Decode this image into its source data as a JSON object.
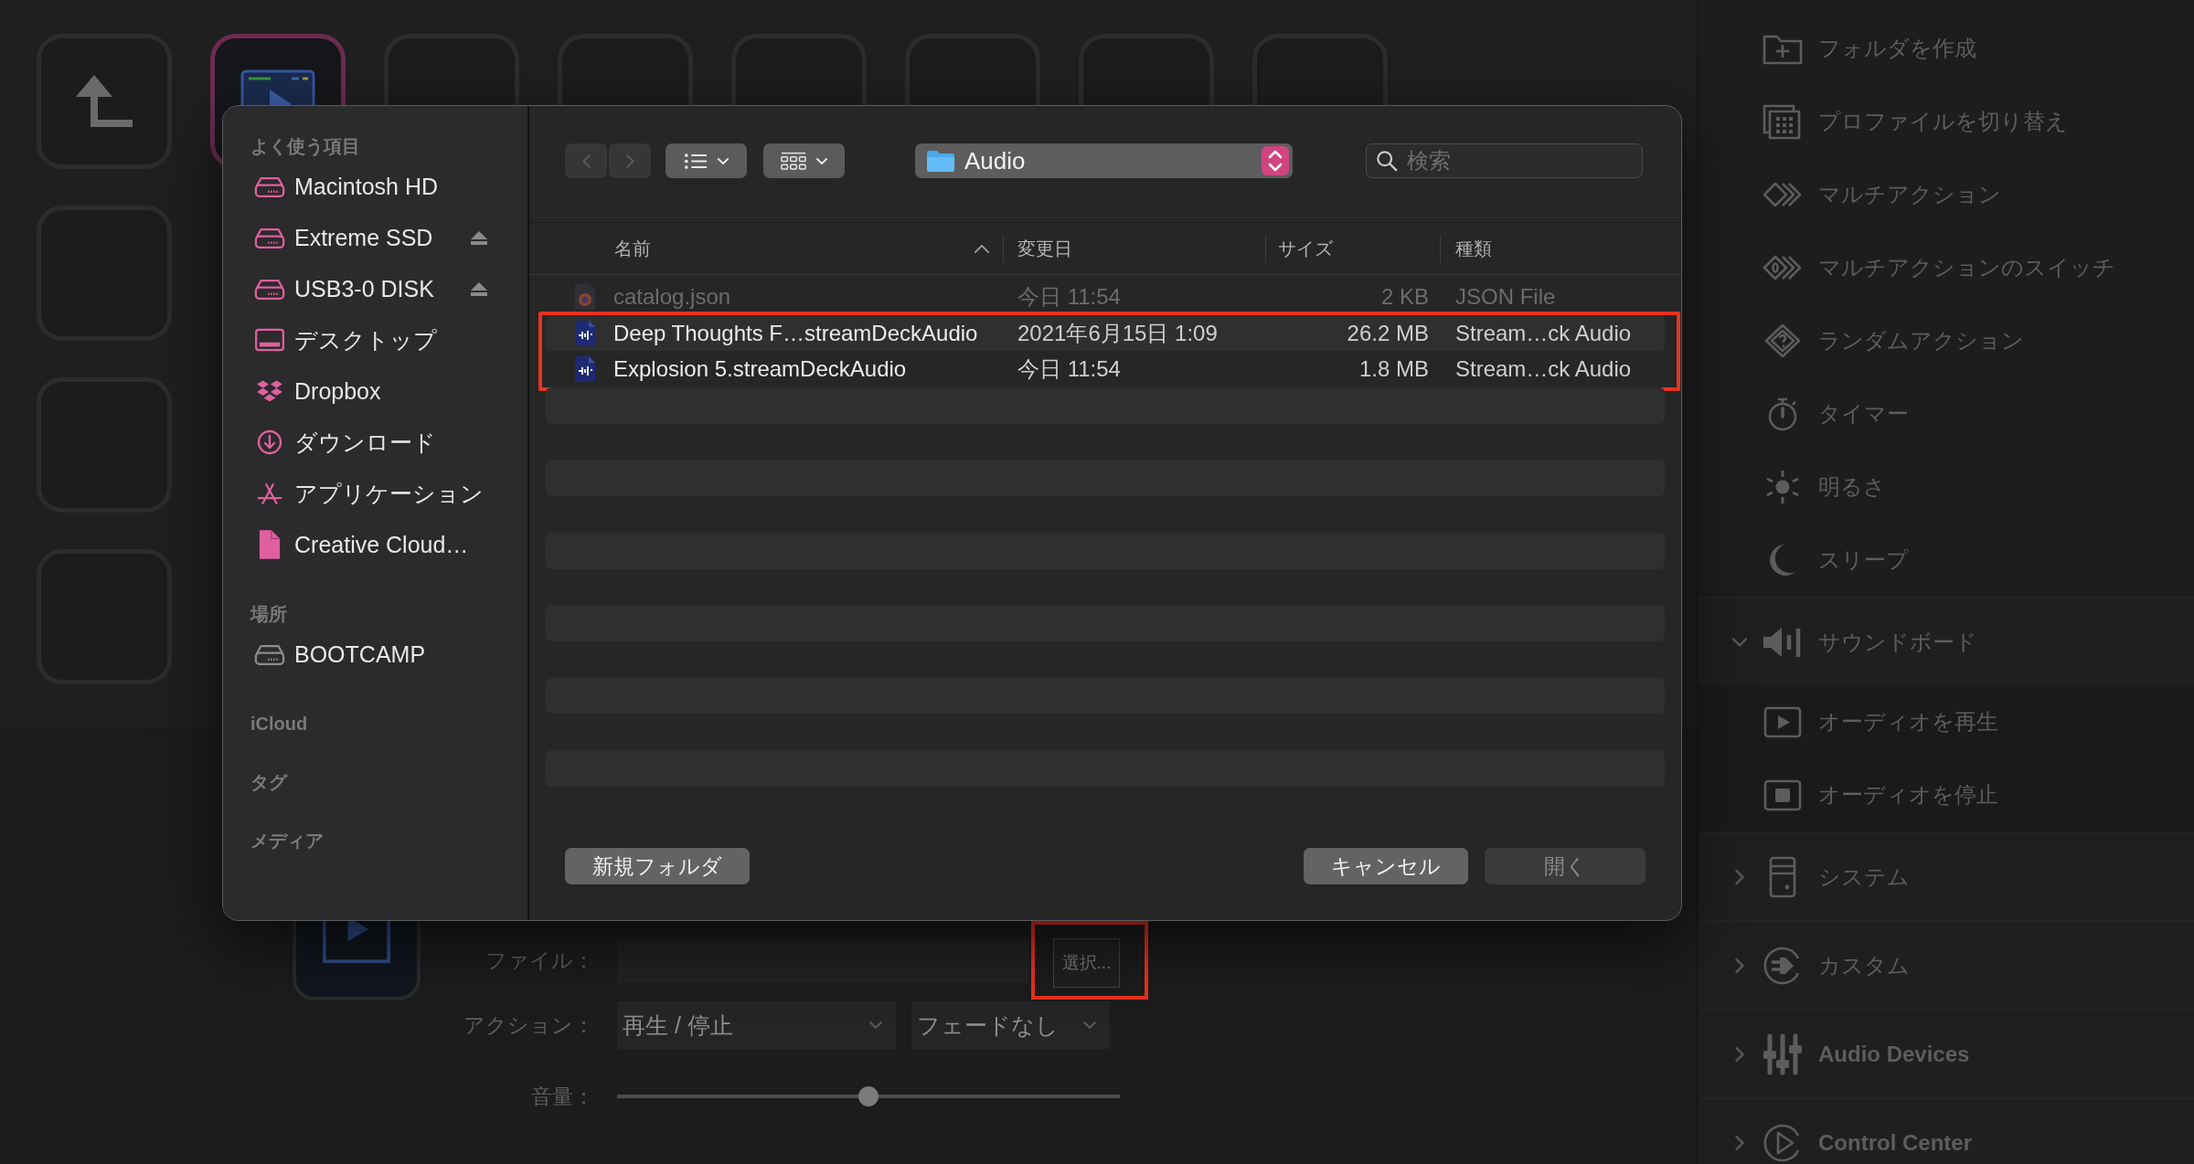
{
  "deck": {
    "rows": [
      {
        "keys": [
          {
            "kind": "back",
            "selected": false
          },
          {
            "kind": "audio",
            "selected": true
          },
          {
            "kind": "empty",
            "selected": false
          },
          {
            "kind": "empty",
            "selected": false
          },
          {
            "kind": "empty",
            "selected": false
          },
          {
            "kind": "empty",
            "selected": false
          },
          {
            "kind": "empty",
            "selected": false
          },
          {
            "kind": "empty",
            "selected": false
          }
        ]
      },
      {
        "keys": [
          {
            "kind": "empty",
            "selected": false
          }
        ]
      },
      {
        "keys": [
          {
            "kind": "empty",
            "selected": false
          }
        ]
      },
      {
        "keys": [
          {
            "kind": "empty",
            "selected": false
          }
        ]
      }
    ]
  },
  "inspector": {
    "file": {
      "label": "ファイル：",
      "button": "選択...",
      "highlighted": true
    },
    "action": {
      "label": "アクション：",
      "mode": "再生 / 停止",
      "fade": "フェードなし"
    },
    "volume": {
      "label": "音量：",
      "level": 0.5
    }
  },
  "dialog": {
    "sidebar": {
      "sections": [
        {
          "title": "よく使う項目",
          "items": [
            {
              "label": "Macintosh HD",
              "kind": "drive",
              "color": "#e0609f",
              "ejectable": false
            },
            {
              "label": "Extreme SSD",
              "kind": "drive",
              "color": "#e0609f",
              "ejectable": true
            },
            {
              "label": "USB3-0 DISK",
              "kind": "drive",
              "color": "#e0609f",
              "ejectable": true
            },
            {
              "label": "デスクトップ",
              "kind": "desktop",
              "color": "#e0609f",
              "ejectable": false
            },
            {
              "label": "Dropbox",
              "kind": "dropbox",
              "color": "#e0609f",
              "ejectable": false
            },
            {
              "label": "ダウンロード",
              "kind": "downloads",
              "color": "#e0609f",
              "ejectable": false
            },
            {
              "label": "アプリケーション",
              "kind": "applications",
              "color": "#e0609f",
              "ejectable": false
            },
            {
              "label": "Creative Cloud…",
              "kind": "document",
              "color": "#e0609f",
              "ejectable": false
            }
          ]
        },
        {
          "title": "場所",
          "items": [
            {
              "label": "BOOTCAMP",
              "kind": "drive",
              "color": "#8c8c8c",
              "ejectable": false
            }
          ]
        },
        {
          "title": "iCloud"
        },
        {
          "title": "タグ"
        },
        {
          "title": "メディア"
        }
      ]
    },
    "toolbar": {
      "back": {
        "disabled": true
      },
      "forward": {
        "disabled": true
      },
      "location": "Audio",
      "search": {
        "placeholder": "検索"
      }
    },
    "files": {
      "columns": [
        {
          "label": "名前",
          "sorted": true
        },
        {
          "label": "変更日",
          "sorted": false
        },
        {
          "label": "サイズ",
          "sorted": false
        },
        {
          "label": "種類",
          "sorted": false
        }
      ],
      "rows": [
        {
          "name": "catalog.json",
          "date": "今日 11:54",
          "size": "2 KB",
          "type": "JSON File",
          "kind": "json",
          "disabled": true,
          "highlighted": false
        },
        {
          "name": "Deep Thoughts F…streamDeckAudio",
          "date": "2021年6月15日 1:09",
          "size": "26.2 MB",
          "type": "Stream…ck Audio",
          "kind": "audio",
          "disabled": false,
          "highlighted": true
        },
        {
          "name": "Explosion 5.streamDeckAudio",
          "date": "今日 11:54",
          "size": "1.8 MB",
          "type": "Stream…ck Audio",
          "kind": "audio",
          "disabled": false,
          "highlighted": true
        }
      ]
    },
    "buttons": [
      {
        "label": "新規フォルダ",
        "disabled": false
      },
      {
        "label": "キャンセル",
        "disabled": false
      },
      {
        "label": "開く",
        "disabled": true
      }
    ]
  },
  "actions": {
    "items": [
      {
        "label": "フォルダを作成",
        "kind": "folder"
      },
      {
        "label": "プロファイルを切り替え",
        "kind": "profile"
      },
      {
        "label": "マルチアクション",
        "kind": "multi"
      },
      {
        "label": "マルチアクションのスイッチ",
        "kind": "multi-switch"
      },
      {
        "label": "ランダムアクション",
        "kind": "random"
      },
      {
        "label": "タイマー",
        "kind": "timer"
      },
      {
        "label": "明るさ",
        "kind": "brightness"
      },
      {
        "label": "スリープ",
        "kind": "sleep"
      }
    ],
    "categories": [
      {
        "label": "サウンドボード",
        "kind": "speaker",
        "expanded": true,
        "bold": false,
        "children": [
          {
            "label": "オーディオを再生",
            "kind": "play"
          },
          {
            "label": "オーディオを停止",
            "kind": "stop"
          }
        ]
      },
      {
        "label": "システム",
        "kind": "tower",
        "expanded": false,
        "bold": false
      },
      {
        "label": "カスタム",
        "kind": "plug",
        "expanded": false,
        "bold": false
      },
      {
        "label": "Audio Devices",
        "kind": "sliders",
        "expanded": false,
        "bold": true
      },
      {
        "label": "Control Center",
        "kind": "play-circle",
        "expanded": false,
        "bold": true
      }
    ]
  }
}
